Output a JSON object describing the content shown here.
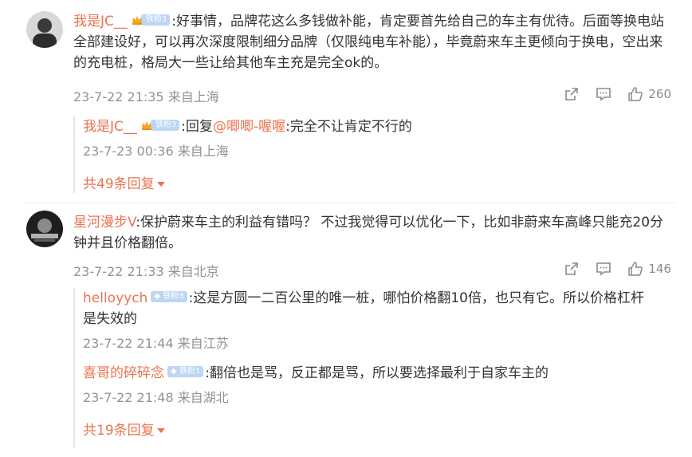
{
  "comments": [
    {
      "username": "我是JC__",
      "fan_badge": "铁粉3",
      "content": ":好事情，品牌花这么多钱做补能，肯定要首先给自己的车主有优待。后面等换电站全部建设好，可以再次深度限制细分品牌（仅限纯电车补能），毕竟蔚来车主更倾向于换电，空出来的充电桩，格局大一些让给其他车主充是完全ok的。",
      "time": "23-7-22 21:35 来自上海",
      "like_count": "260",
      "replies": [
        {
          "username": "我是JC__",
          "fan_badge": "铁粉3",
          "reply_prefix": ":回复",
          "mention": "@唧唧-喔喔",
          "content": ":完全不让肯定不行的",
          "time": "23-7-23 00:36 来自上海"
        }
      ],
      "more_replies": "共49条回复"
    },
    {
      "username": "星河漫步V",
      "content": ":保护蔚来车主的利益有错吗？ 不过我觉得可以优化一下，比如非蔚来车高峰只能充20分钟并且价格翻倍。",
      "time": "23-7-22 21:33 来自北京",
      "like_count": "146",
      "replies": [
        {
          "username": "helloyych",
          "fan_badge": "铁粉3",
          "content": ":这是方圆一二百公里的唯一桩，哪怕价格翻10倍，也只有它。所以价格杠杆是失效的",
          "time": "23-7-22 21:44 来自江苏"
        },
        {
          "username": "喜哥的碎碎念",
          "fan_badge": "铁粉1",
          "content": ":翻倍也是骂，反正都是骂，所以要选择最利于自家车主的",
          "time": "23-7-22 21:48 来自湖北"
        }
      ],
      "more_replies": "共19条回复"
    }
  ],
  "colors": {
    "username": "#eb7350",
    "meta": "#939393",
    "badge": "#bcd6f5",
    "crown": "#f5a623"
  },
  "icons": [
    "share-icon",
    "comment-icon",
    "like-icon",
    "crown-icon",
    "diamond-icon"
  ]
}
